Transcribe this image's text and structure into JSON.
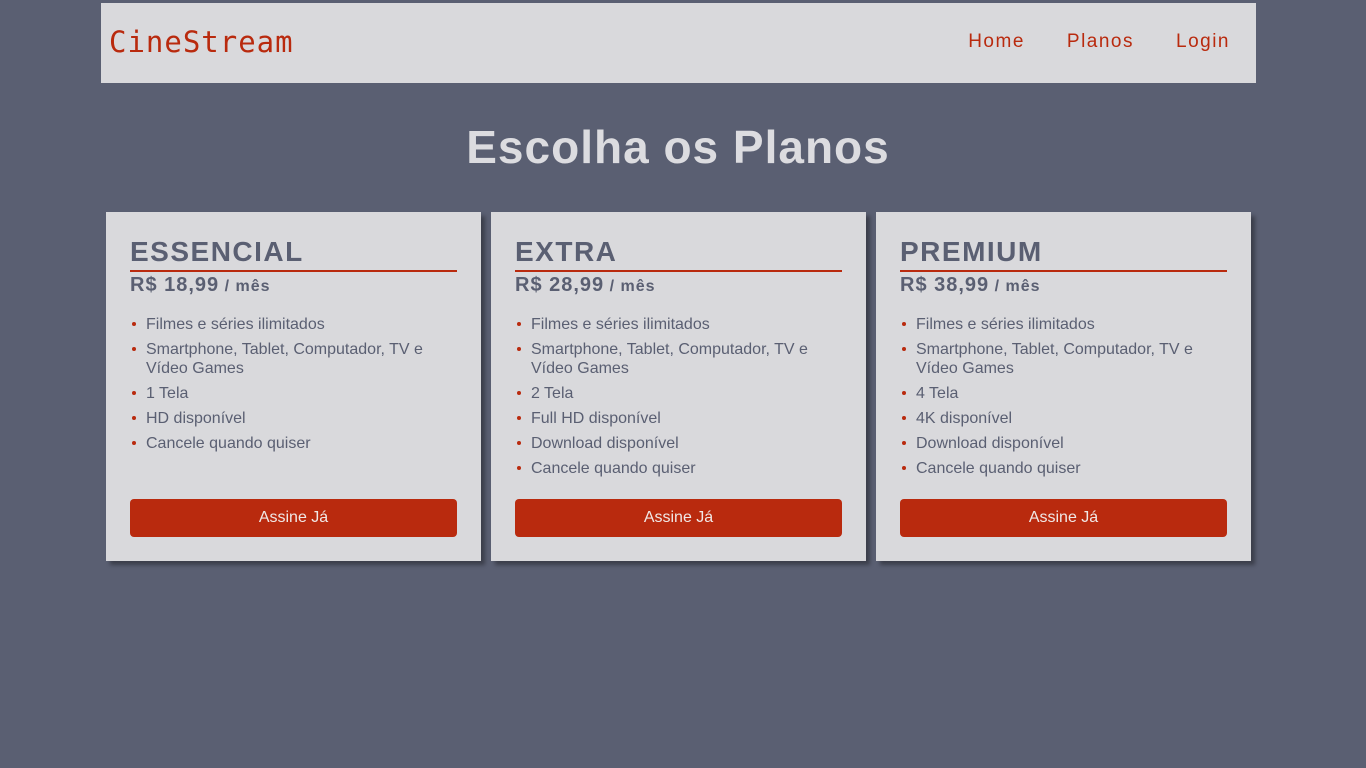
{
  "header": {
    "logo": "CineStream",
    "nav": [
      "Home",
      "Planos",
      "Login"
    ]
  },
  "page_title": "Escolha os Planos",
  "colors": {
    "background": "#5a5f72",
    "panel": "#d9d9dc",
    "accent": "#b92a0e",
    "text": "#5a5f72"
  },
  "plans": [
    {
      "name": "ESSENCIAL",
      "price": "R$ 18,99",
      "period": "/ mês",
      "features": [
        "Filmes e séries ilimitados",
        "Smartphone, Tablet, Computador, TV e Vídeo Games",
        "1 Tela",
        "HD disponível",
        "Cancele quando quiser"
      ],
      "button": "Assine Já"
    },
    {
      "name": "EXTRA",
      "price": "R$ 28,99",
      "period": "/ mês",
      "features": [
        "Filmes e séries ilimitados",
        "Smartphone, Tablet, Computador, TV e Vídeo Games",
        "2 Tela",
        "Full HD disponível",
        "Download disponível",
        "Cancele quando quiser"
      ],
      "button": "Assine Já"
    },
    {
      "name": "PREMIUM",
      "price": "R$ 38,99",
      "period": "/ mês",
      "features": [
        "Filmes e séries ilimitados",
        "Smartphone, Tablet, Computador, TV e Vídeo Games",
        "4 Tela",
        "4K disponível",
        "Download disponível",
        "Cancele quando quiser"
      ],
      "button": "Assine Já"
    }
  ]
}
